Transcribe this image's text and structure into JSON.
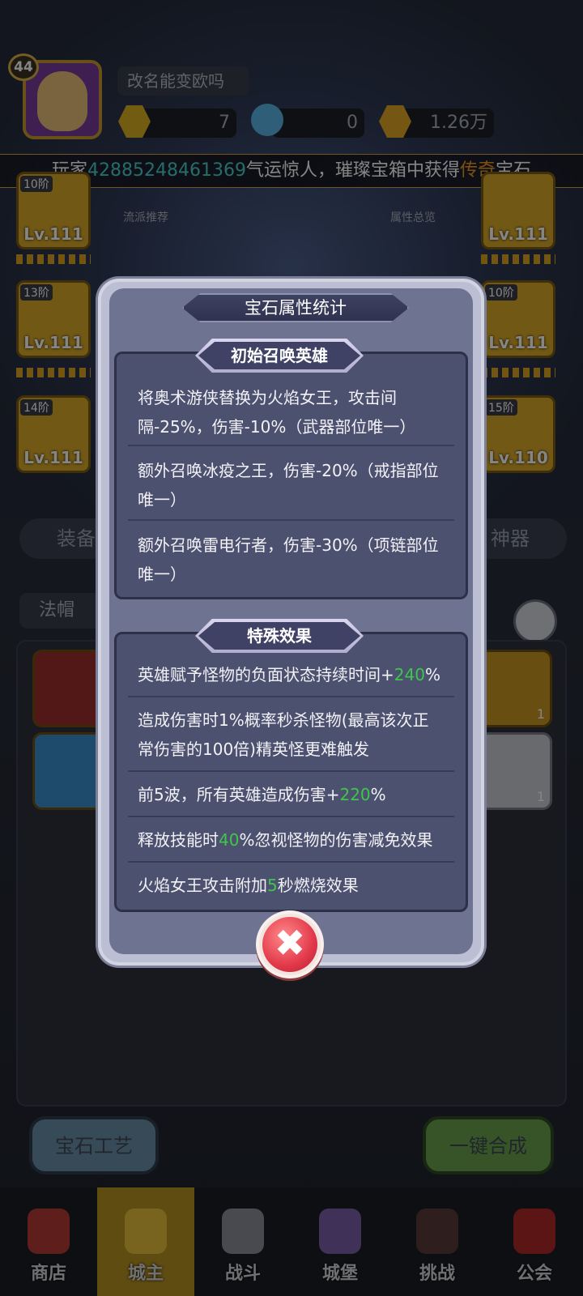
{
  "player": {
    "level": "44",
    "name": "改名能变欧吗"
  },
  "resources": [
    {
      "name": "gem-resource",
      "value": "7"
    },
    {
      "name": "potion-resource",
      "value": "0"
    },
    {
      "name": "gold-resource",
      "value": "1.26万"
    }
  ],
  "ticker": {
    "prefix": "玩家",
    "player_id": "42885248461369",
    "middle": "气运惊人，璀璨宝箱中获得",
    "rarity": "传奇",
    "suffix": "宝石"
  },
  "hero_buttons": {
    "recommend": "流派推荐",
    "overview": "属性总览"
  },
  "equipment_slots": [
    {
      "tier": "10阶",
      "level": "Lv.111"
    },
    {
      "tier": "13阶",
      "level": "Lv.111"
    },
    {
      "tier": "14阶",
      "level": "Lv.111"
    },
    {
      "tier": "",
      "level": "Lv.111"
    },
    {
      "tier": "10阶",
      "level": "Lv.111"
    },
    {
      "tier": "15阶",
      "level": "Lv.110"
    }
  ],
  "tabs": {
    "equipment": "装备",
    "artifact": "神器"
  },
  "filter": {
    "selected": "法帽"
  },
  "gem_counts": [
    "1",
    "1"
  ],
  "bottom_buttons": {
    "craft": "宝石工艺",
    "merge": "一键合成"
  },
  "nav": [
    {
      "label": "商店"
    },
    {
      "label": "城主"
    },
    {
      "label": "战斗"
    },
    {
      "label": "城堡"
    },
    {
      "label": "挑战"
    },
    {
      "label": "公会"
    }
  ],
  "modal": {
    "title": "宝石属性统计",
    "summon_section": {
      "heading": "初始召唤英雄",
      "rows": [
        "将奥术游侠替换为火焰女王，攻击间隔-25%，伤害-10%（武器部位唯一）",
        "额外召唤冰疫之王，伤害-20%（戒指部位唯一）",
        "额外召唤雷电行者，伤害-30%（项链部位唯一）"
      ]
    },
    "special_section": {
      "heading": "特殊效果",
      "rows": [
        {
          "text": "英雄赋予怪物的负面状态持续时间+",
          "value": "240",
          "tail": "%"
        },
        {
          "text": "造成伤害时1%概率秒杀怪物(最高该次正常伤害的100倍)精英怪更难触发",
          "value": "",
          "tail": ""
        },
        {
          "text": "前5波，所有英雄造成伤害+",
          "value": "220",
          "tail": "%"
        },
        {
          "text": "释放技能时",
          "value": "40",
          "tail": "%忽视怪物的伤害减免效果"
        },
        {
          "text": "火焰女王攻击附加",
          "value": "5",
          "tail": "秒燃烧效果"
        }
      ]
    },
    "colors": {
      "highlight": "#3fc64a",
      "ticker_id": "#49d0d0",
      "rarity": "#f39a1a"
    }
  }
}
